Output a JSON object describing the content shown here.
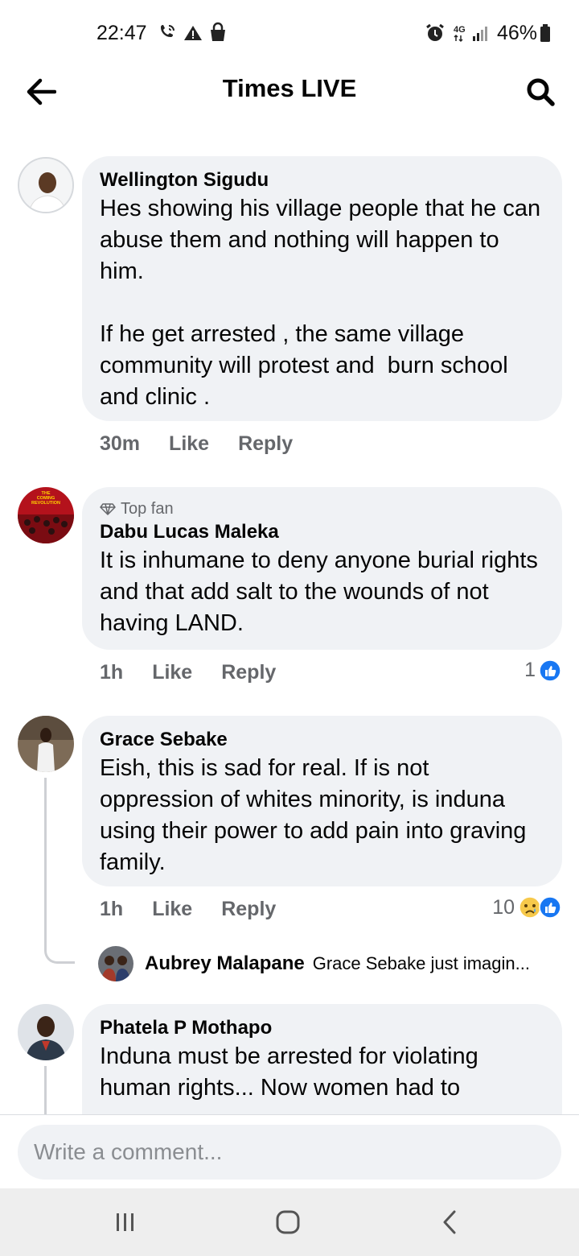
{
  "status_bar": {
    "time": "22:47",
    "network": "4G",
    "battery": "46%",
    "icons": [
      "wifi-calling-icon",
      "warning-icon",
      "shopping-bag-icon",
      "alarm-icon",
      "signal-icon",
      "battery-icon"
    ]
  },
  "header": {
    "title": "Times LIVE",
    "back_icon": "arrow-left-icon",
    "search_icon": "search-icon"
  },
  "comments": [
    {
      "author": "Wellington Sigudu",
      "text": "Hes showing his village people that he can abuse them and nothing will happen to him.\n\nIf he get arrested , the same village community will protest and  burn school and clinic .",
      "time": "30m",
      "like_label": "Like",
      "reply_label": "Reply"
    },
    {
      "badge": "Top fan",
      "author": "Dabu Lucas Maleka",
      "text": "It is inhumane to deny anyone burial rights and that add salt to the wounds of not having LAND.",
      "time": "1h",
      "like_label": "Like",
      "reply_label": "Reply",
      "reaction_count": "1",
      "avatar_text": "THE COMING REVOLUTION"
    },
    {
      "author": "Grace Sebake",
      "text": "Eish, this is sad for real. If is not oppression of whites minority, is induna using their power to add pain into graving family.",
      "time": "1h",
      "like_label": "Like",
      "reply_label": "Reply",
      "reaction_count": "10",
      "reply_preview": {
        "author": "Aubrey Malapane",
        "text": "Grace Sebake just imagin..."
      }
    },
    {
      "author": "Phatela P Mothapo",
      "text": "Induna must be arrested for violating human rights... Now women had to"
    }
  ],
  "composer": {
    "placeholder": "Write a comment..."
  },
  "colors": {
    "bubble": "#f0f2f5",
    "secondary_text": "#65676b",
    "like_blue": "#1877f2",
    "nav_bg": "#eeeeee"
  }
}
